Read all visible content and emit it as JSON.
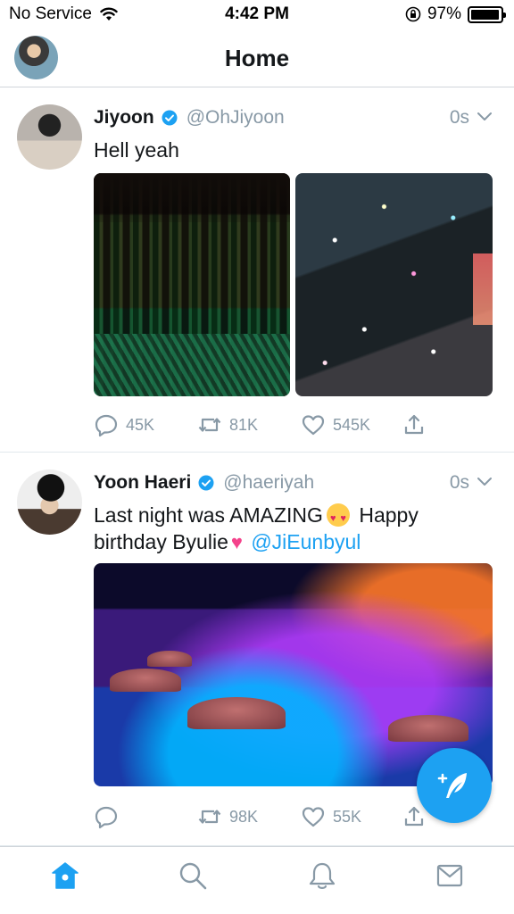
{
  "status_bar": {
    "carrier": "No Service",
    "time": "4:42 PM",
    "battery_percent": "97%",
    "battery_level": 0.97
  },
  "header": {
    "title": "Home"
  },
  "tweets": [
    {
      "name": "Jiyoon",
      "handle": "@OhJiyoon",
      "time": "0s",
      "text": "Hell yeah",
      "replies": "45K",
      "retweets": "81K",
      "likes": "545K"
    },
    {
      "name": "Yoon Haeri",
      "handle": "@haeriyah",
      "time": "0s",
      "text_part1": "Last night was AMAZING",
      "text_part2": "Happy birthday Byulie",
      "mention": "@JiEunbyul",
      "retweets": "98K",
      "likes": "55K"
    }
  ],
  "colors": {
    "accent": "#1da1f2",
    "secondary_text": "#8899a6",
    "primary_text": "#14171a"
  },
  "icons": {
    "status": [
      "wifi-icon",
      "orientation-lock-icon",
      "battery-icon"
    ],
    "tweet_actions": [
      "reply-icon",
      "retweet-icon",
      "like-icon",
      "share-icon"
    ],
    "tabs": [
      "home-icon",
      "search-icon",
      "notifications-icon",
      "messages-icon"
    ],
    "fab": "compose-tweet-icon"
  }
}
